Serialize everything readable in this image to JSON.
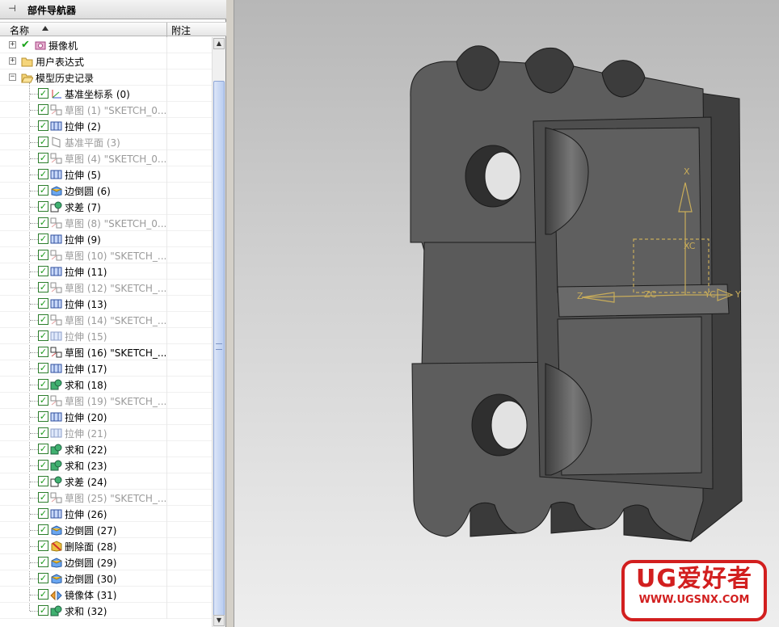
{
  "navigator": {
    "title": "部件导航器",
    "columns": {
      "name": "名称",
      "note": "附注"
    },
    "top_items": [
      {
        "label": "摄像机",
        "icon": "camera-icon",
        "expander": "+"
      },
      {
        "label": "用户表达式",
        "icon": "folder-icon",
        "expander": "+"
      },
      {
        "label": "模型历史记录",
        "icon": "folder-open-icon",
        "expander": "-"
      }
    ],
    "features": [
      {
        "label": "基准坐标系 (0)",
        "icon": "datum-csys-icon",
        "dimmed": false
      },
      {
        "label": "草图 (1) \"SKETCH_0...",
        "icon": "sketch-icon",
        "dimmed": true
      },
      {
        "label": "拉伸 (2)",
        "icon": "extrude-icon",
        "dimmed": false
      },
      {
        "label": "基准平面 (3)",
        "icon": "datum-plane-icon",
        "dimmed": true
      },
      {
        "label": "草图 (4) \"SKETCH_0...",
        "icon": "sketch-icon",
        "dimmed": true
      },
      {
        "label": "拉伸 (5)",
        "icon": "extrude-icon",
        "dimmed": false
      },
      {
        "label": "边倒圆 (6)",
        "icon": "edge-blend-icon",
        "dimmed": false
      },
      {
        "label": "求差 (7)",
        "icon": "subtract-icon",
        "dimmed": false
      },
      {
        "label": "草图 (8) \"SKETCH_0...",
        "icon": "sketch-icon",
        "dimmed": true
      },
      {
        "label": "拉伸 (9)",
        "icon": "extrude-icon",
        "dimmed": false
      },
      {
        "label": "草图 (10) \"SKETCH_...",
        "icon": "sketch-icon",
        "dimmed": true
      },
      {
        "label": "拉伸 (11)",
        "icon": "extrude-icon",
        "dimmed": false
      },
      {
        "label": "草图 (12) \"SKETCH_...",
        "icon": "sketch-icon",
        "dimmed": true
      },
      {
        "label": "拉伸 (13)",
        "icon": "extrude-icon",
        "dimmed": false
      },
      {
        "label": "草图 (14) \"SKETCH_...",
        "icon": "sketch-icon",
        "dimmed": true
      },
      {
        "label": "拉伸 (15)",
        "icon": "extrude-icon",
        "dimmed": true
      },
      {
        "label": "草图 (16) \"SKETCH_...",
        "icon": "sketch-icon",
        "dimmed": false
      },
      {
        "label": "拉伸 (17)",
        "icon": "extrude-icon",
        "dimmed": false
      },
      {
        "label": "求和 (18)",
        "icon": "unite-icon",
        "dimmed": false
      },
      {
        "label": "草图 (19) \"SKETCH_...",
        "icon": "sketch-icon",
        "dimmed": true
      },
      {
        "label": "拉伸 (20)",
        "icon": "extrude-icon",
        "dimmed": false
      },
      {
        "label": "拉伸 (21)",
        "icon": "extrude-icon",
        "dimmed": true
      },
      {
        "label": "求和 (22)",
        "icon": "unite-icon",
        "dimmed": false
      },
      {
        "label": "求和 (23)",
        "icon": "unite-icon",
        "dimmed": false
      },
      {
        "label": "求差 (24)",
        "icon": "subtract-icon",
        "dimmed": false
      },
      {
        "label": "草图 (25) \"SKETCH_...",
        "icon": "sketch-icon",
        "dimmed": true
      },
      {
        "label": "拉伸 (26)",
        "icon": "extrude-icon",
        "dimmed": false
      },
      {
        "label": "边倒圆 (27)",
        "icon": "edge-blend-icon",
        "dimmed": false
      },
      {
        "label": "删除面 (28)",
        "icon": "delete-face-icon",
        "dimmed": false
      },
      {
        "label": "边倒圆 (29)",
        "icon": "edge-blend-icon",
        "dimmed": false
      },
      {
        "label": "边倒圆 (30)",
        "icon": "edge-blend-icon",
        "dimmed": false
      },
      {
        "label": "镜像体 (31)",
        "icon": "mirror-body-icon",
        "dimmed": false
      },
      {
        "label": "求和 (32)",
        "icon": "unite-icon",
        "dimmed": false
      }
    ]
  },
  "viewport": {
    "wcs_labels": {
      "x": "X",
      "xc": "XC",
      "zc": "ZC",
      "yc": "YC",
      "z": "Z",
      "y": "Y"
    },
    "colors": {
      "body": "#5d5d5d",
      "body_dark": "#444444",
      "body_light": "#6f6f6f",
      "edge": "#1c1c1c",
      "wcs": "#c8ac5a"
    }
  },
  "watermark": {
    "big": "UG爱好者",
    "small": "WWW.UGSNX.COM",
    "color": "#d21f1f"
  }
}
